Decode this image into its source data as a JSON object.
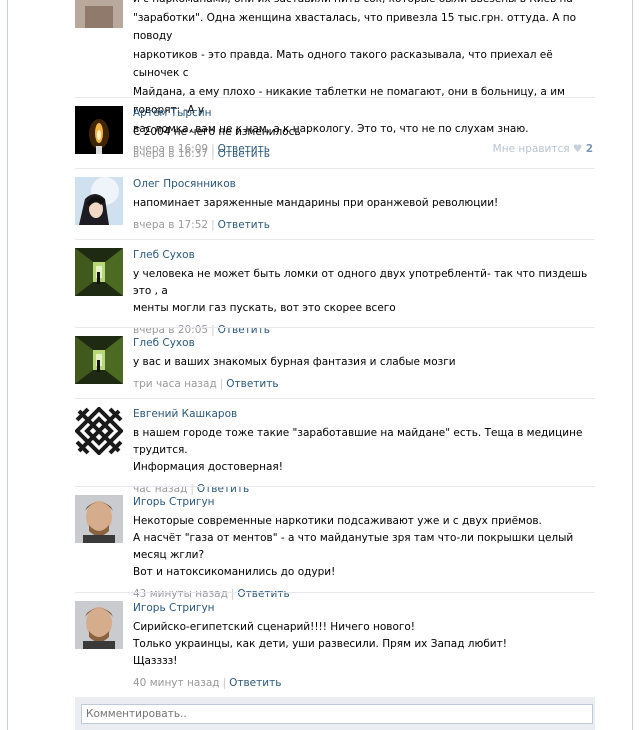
{
  "comments": [
    {
      "author": "",
      "text": "и с наркоманами, они их заставили пить сок, которые были ввезены в Киев на\n\"заработки\". Одна женщина хвасталась, что привезла 15 тыс.грн. оттуда. А по поводу\nнаркотиков - это правда. Мать одного такого расказывала, что приехал её сыночек с\nМайдана, а ему плохо - никакие таблетки не помагают, они в больницу, а им говорят: -А у\nвас ломка, вам не к нам, а к наркологу. Это то, что не по слухам знаю.",
      "time": "вчера в 16:09",
      "reply": "Ответить",
      "likes_label": "Мне нравится",
      "likes_count": "2"
    },
    {
      "author": "Артём Тырсин",
      "text": "С 2004 не чего не изменилось",
      "time": "вчера в 16:37",
      "reply": "Ответить"
    },
    {
      "author": "Олег Просянников",
      "text": "напоминает заряженные мандарины при оранжевой революции!",
      "time": "вчера в 17:52",
      "reply": "Ответить"
    },
    {
      "author": "Глеб Сухов",
      "text": "у человека не может быть ломки от одного двух употреблентй- так что пиздешь это , а\nменты могли газ пускать, вот это скорее всего",
      "time": "вчера в 20:05",
      "reply": "Ответить"
    },
    {
      "author": "Глеб Сухов",
      "text": "у вас и ваших знакомых бурная фантазия и слабые мозги",
      "time": "три часа назад",
      "reply": "Ответить"
    },
    {
      "author": "Евгений Кашкаров",
      "text": "в нашем городе тоже такие \"заработавшие на майдане\" есть. Теща в медицине трудится.\nИнформация достоверная!",
      "time": "час назад",
      "reply": "Ответить"
    },
    {
      "author": "Игорь Стригун",
      "text": "Некоторые современные наркотики подсаживают уже и с двух приёмов.\nА насчёт \"газа от ментов\" - а что майданутые зря там что-ли покрышки целый месяц жгли?\nВот и натоксикоманились до одури!",
      "time": "43 минуты назад",
      "reply": "Ответить"
    },
    {
      "author": "Игорь Стригун",
      "text": "Сирийско-египетский сценарий!!!! Ничего нового!\nТолько украинцы, как дети, уши развесили. Прям их Запад любит!\nЩазззз!",
      "time": "40 минут назад",
      "reply": "Ответить"
    }
  ],
  "reply_box": {
    "placeholder": "Комментировать.."
  }
}
